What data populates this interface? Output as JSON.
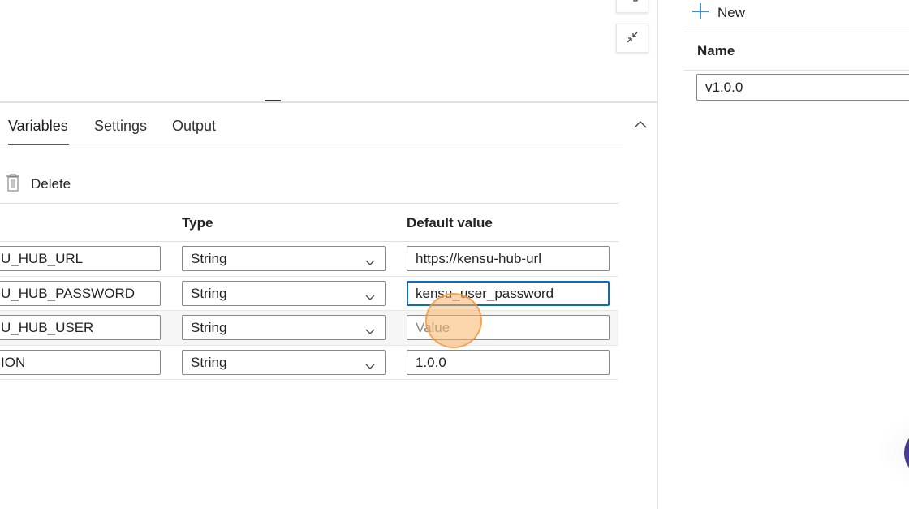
{
  "tabs": [
    {
      "label": "Variables",
      "active": true
    },
    {
      "label": "Settings",
      "active": false
    },
    {
      "label": "Output",
      "active": false
    }
  ],
  "toolbar": {
    "delete_label": "Delete"
  },
  "table": {
    "headers": {
      "type": "Type",
      "default_value": "Default value"
    },
    "rows": [
      {
        "name": "U_HUB_URL",
        "type": "String",
        "value": "https://kensu-hub-url",
        "placeholder": ""
      },
      {
        "name": "U_HUB_PASSWORD",
        "type": "String",
        "value": "kensu_user_password",
        "placeholder": ""
      },
      {
        "name": "U_HUB_USER",
        "type": "String",
        "value": "",
        "placeholder": "Value"
      },
      {
        "name": "ION",
        "type": "String",
        "value": "1.0.0",
        "placeholder": ""
      }
    ]
  },
  "right_panel": {
    "new_label": "New",
    "name_header": "Name",
    "name_value": "v1.0.0"
  },
  "colors": {
    "accent": "#0f6cbd",
    "click_indicator": "#f7b267",
    "avatar": "#4b3a8f"
  },
  "icons": [
    "expand-icon",
    "collapse-icon",
    "chevron-up-icon",
    "trash-icon",
    "chevron-down-icon",
    "plus-icon"
  ]
}
